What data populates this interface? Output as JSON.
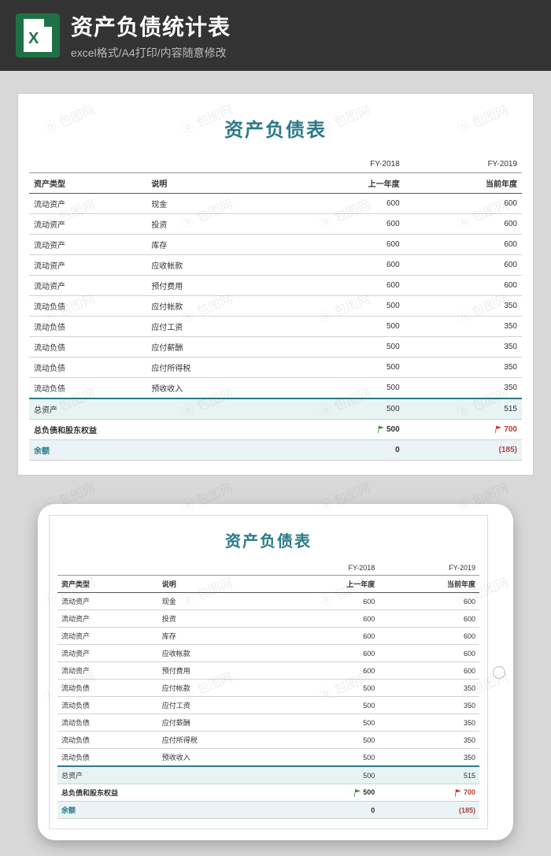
{
  "header": {
    "title": "资产负债统计表",
    "subtitle": "excel格式/A4打印/内容随意修改",
    "icon_letter": "X"
  },
  "sheet": {
    "title": "资产负债表",
    "fy_labels": {
      "prev": "FY-2018",
      "curr": "FY-2019"
    },
    "columns": {
      "type": "资产类型",
      "desc": "说明",
      "prev": "上一年度",
      "curr": "当前年度"
    },
    "rows": [
      {
        "type": "流动资产",
        "desc": "现金",
        "prev": "600",
        "curr": "600"
      },
      {
        "type": "流动资产",
        "desc": "投资",
        "prev": "600",
        "curr": "600"
      },
      {
        "type": "流动资产",
        "desc": "库存",
        "prev": "600",
        "curr": "600"
      },
      {
        "type": "流动资产",
        "desc": "应收帐款",
        "prev": "600",
        "curr": "600"
      },
      {
        "type": "流动资产",
        "desc": "预付费用",
        "prev": "600",
        "curr": "600"
      },
      {
        "type": "流动负债",
        "desc": "应付帐款",
        "prev": "500",
        "curr": "350"
      },
      {
        "type": "流动负债",
        "desc": "应付工资",
        "prev": "500",
        "curr": "350"
      },
      {
        "type": "流动负债",
        "desc": "应付薪酬",
        "prev": "500",
        "curr": "350"
      },
      {
        "type": "流动负债",
        "desc": "应付所得税",
        "prev": "500",
        "curr": "350"
      },
      {
        "type": "流动负债",
        "desc": "预收收入",
        "prev": "500",
        "curr": "350"
      }
    ],
    "totals_label": "总资产",
    "totals": {
      "prev": "500",
      "curr": "515"
    },
    "equity_label": "总负债和股东权益",
    "equity": {
      "prev": "500",
      "curr": "700"
    },
    "balance_label": "余额",
    "balance": {
      "prev": "0",
      "curr": "(185)"
    }
  },
  "watermark": "包图网"
}
